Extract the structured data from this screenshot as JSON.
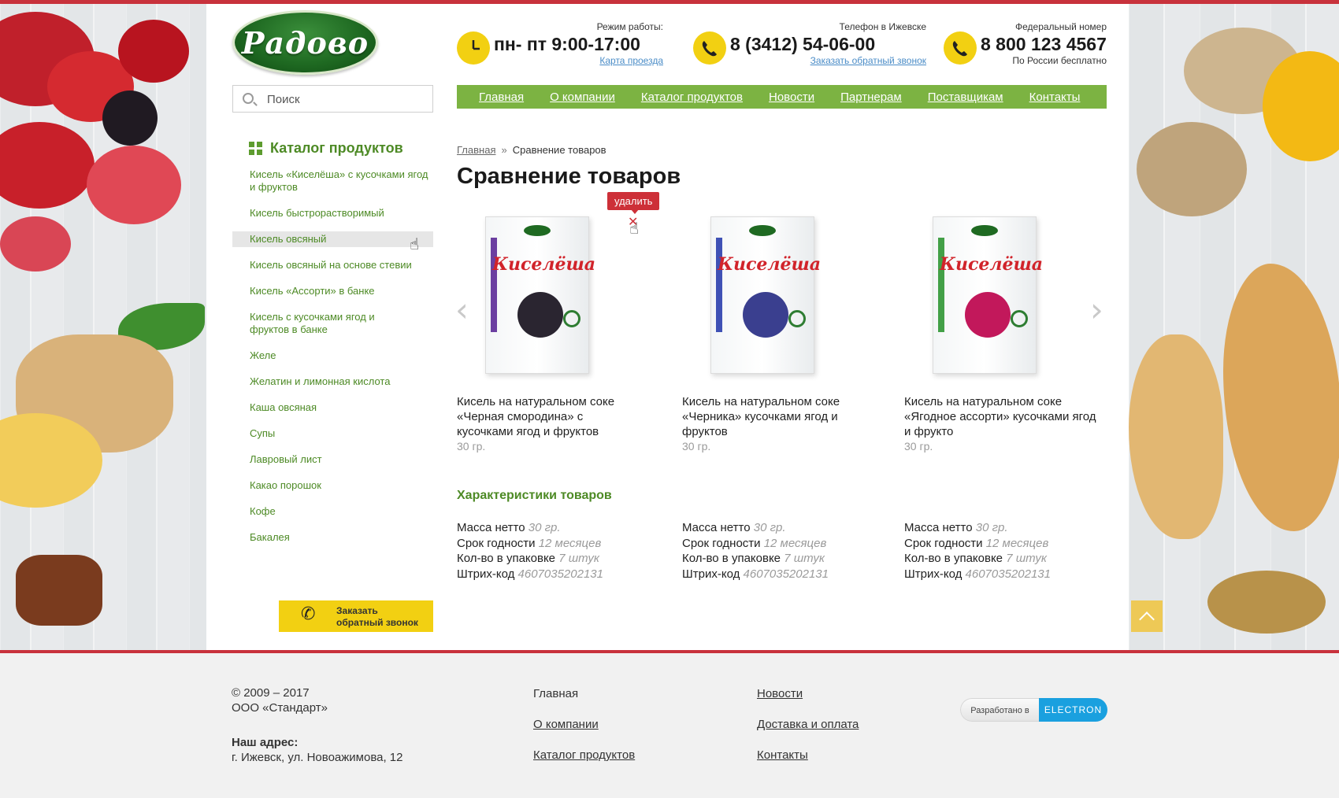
{
  "brand": {
    "logo_text": "Радово"
  },
  "search": {
    "placeholder": "Поиск"
  },
  "header": {
    "hours": {
      "label": "Режим работы:",
      "value": "пн- пт 9:00-17:00",
      "link": "Карта проезда"
    },
    "local_phone": {
      "label": "Телефон в Ижевске",
      "value": "8 (3412) 54-06-00",
      "link": "Заказать обратный звонок"
    },
    "federal_phone": {
      "label": "Федеральный номер",
      "value": "8 800 123 4567",
      "sub": "По России бесплатно"
    }
  },
  "nav": [
    "Главная",
    "О компании",
    "Каталог продуктов",
    "Новости",
    "Партнерам",
    "Поставщикам",
    "Контакты"
  ],
  "sidebar": {
    "title": "Каталог продуктов",
    "items": [
      "Кисель «Киселёша» с кусочками ягод и фруктов",
      "Кисель быстрорастворимый",
      "Кисель овсяный",
      "Кисель овсяный на основе стевии",
      "Кисель «Ассорти» в банке",
      "Кисель с кусочками ягод и фруктов в банке",
      "Желе",
      "Желатин и лимонная кислота",
      "Каша овсяная",
      "Супы",
      "Лавровый лист",
      "Какао порошок",
      "Кофе",
      "Бакалея"
    ],
    "active_index": 2,
    "callback_button": "Заказать обратный звонок"
  },
  "breadcrumb": {
    "home": "Главная",
    "separator": "»",
    "current": "Сравнение товаров"
  },
  "page_title": "Сравнение товаров",
  "delete_tooltip": "удалить",
  "products": [
    {
      "package_text": "Киселёша",
      "name": "Кисель на натуральном соке «Черная смородина» с кусочками ягод и фруктов",
      "weight": "30 гр.",
      "berry_color": "#2a2530",
      "strip_color": "#6b3fa0"
    },
    {
      "package_text": "Киселёша",
      "name": "Кисель на натуральном соке «Черника» кусочками ягод и фруктов",
      "weight": "30 гр.",
      "berry_color": "#3a3f8f",
      "strip_color": "#3f51b5"
    },
    {
      "package_text": "Киселёша",
      "name": "Кисель на натуральном соке «Ягодное ассорти» кусочками ягод и фрукто",
      "weight": "30 гр.",
      "berry_color": "#c2185b",
      "strip_color": "#43a047"
    }
  ],
  "characteristics": {
    "title": "Характеристики товаров",
    "labels": [
      "Масса нетто",
      "Срок годности",
      "Кол-во в упаковке",
      "Штрих-код"
    ],
    "values": [
      [
        "30 гр.",
        "12 месяцев",
        "7 штук",
        "4607035202131"
      ],
      [
        "30 гр.",
        "12 месяцев",
        "7 штук",
        "4607035202131"
      ],
      [
        "30 гр.",
        "12 месяцев",
        "7 штук",
        "4607035202131"
      ]
    ]
  },
  "footer": {
    "copyright": "© 2009 – 2017",
    "company": "ООО «Стандарт»",
    "address_label": "Наш адрес:",
    "address": "г. Ижевск, ул. Новоажимова, 12",
    "col1": [
      "Главная",
      "О компании",
      "Каталог продуктов"
    ],
    "col2": [
      "Новости",
      "Доставка и оплата",
      "Контакты"
    ],
    "dev_label": "Разработано в",
    "dev_brand": "ELECTRON"
  },
  "colors": {
    "accent_red": "#c8323c",
    "nav_green": "#7cb342",
    "text_green": "#4d8a25",
    "yellow": "#f2d012",
    "electron_blue": "#1aa0df"
  }
}
